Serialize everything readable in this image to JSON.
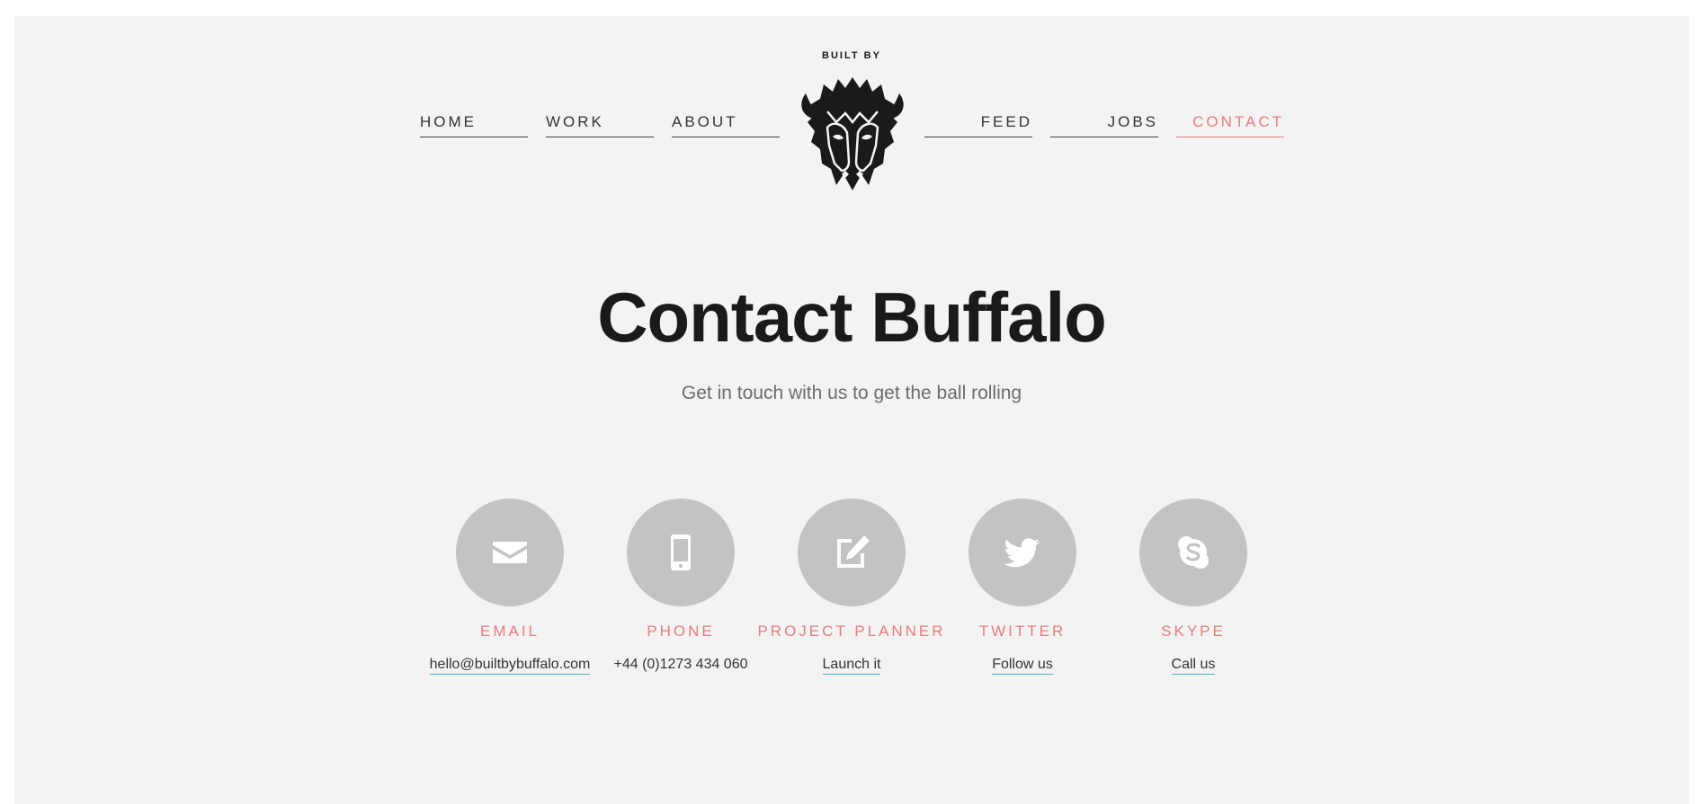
{
  "header": {
    "built_by": "BUILT BY",
    "logo_icon": "buffalo-head-icon"
  },
  "nav": {
    "left": [
      {
        "label": "HOME"
      },
      {
        "label": "WORK"
      },
      {
        "label": "ABOUT"
      }
    ],
    "right": [
      {
        "label": "FEED"
      },
      {
        "label": "JOBS"
      },
      {
        "label": "CONTACT",
        "active": true
      }
    ],
    "active_color": "#e87b7b"
  },
  "main": {
    "title": "Contact Buffalo",
    "subtitle": "Get in touch with us to get the ball rolling"
  },
  "contacts": [
    {
      "icon": "envelope-icon",
      "label": "EMAIL",
      "value": "hello@builtbybuffalo.com",
      "link": true
    },
    {
      "icon": "mobile-phone-icon",
      "label": "PHONE",
      "value": "+44 (0)1273 434 060",
      "link": false
    },
    {
      "icon": "edit-icon",
      "label": "PROJECT PLANNER",
      "value": "Launch it",
      "link": true
    },
    {
      "icon": "twitter-icon",
      "label": "TWITTER",
      "value": "Follow us",
      "link": true
    },
    {
      "icon": "skype-icon",
      "label": "SKYPE",
      "value": "Call us",
      "link": true
    }
  ],
  "colors": {
    "accent": "#e87b7b",
    "link_underline": "#3bb6c6",
    "circle": "#c3c3c3",
    "background": "#f3f3f3"
  }
}
